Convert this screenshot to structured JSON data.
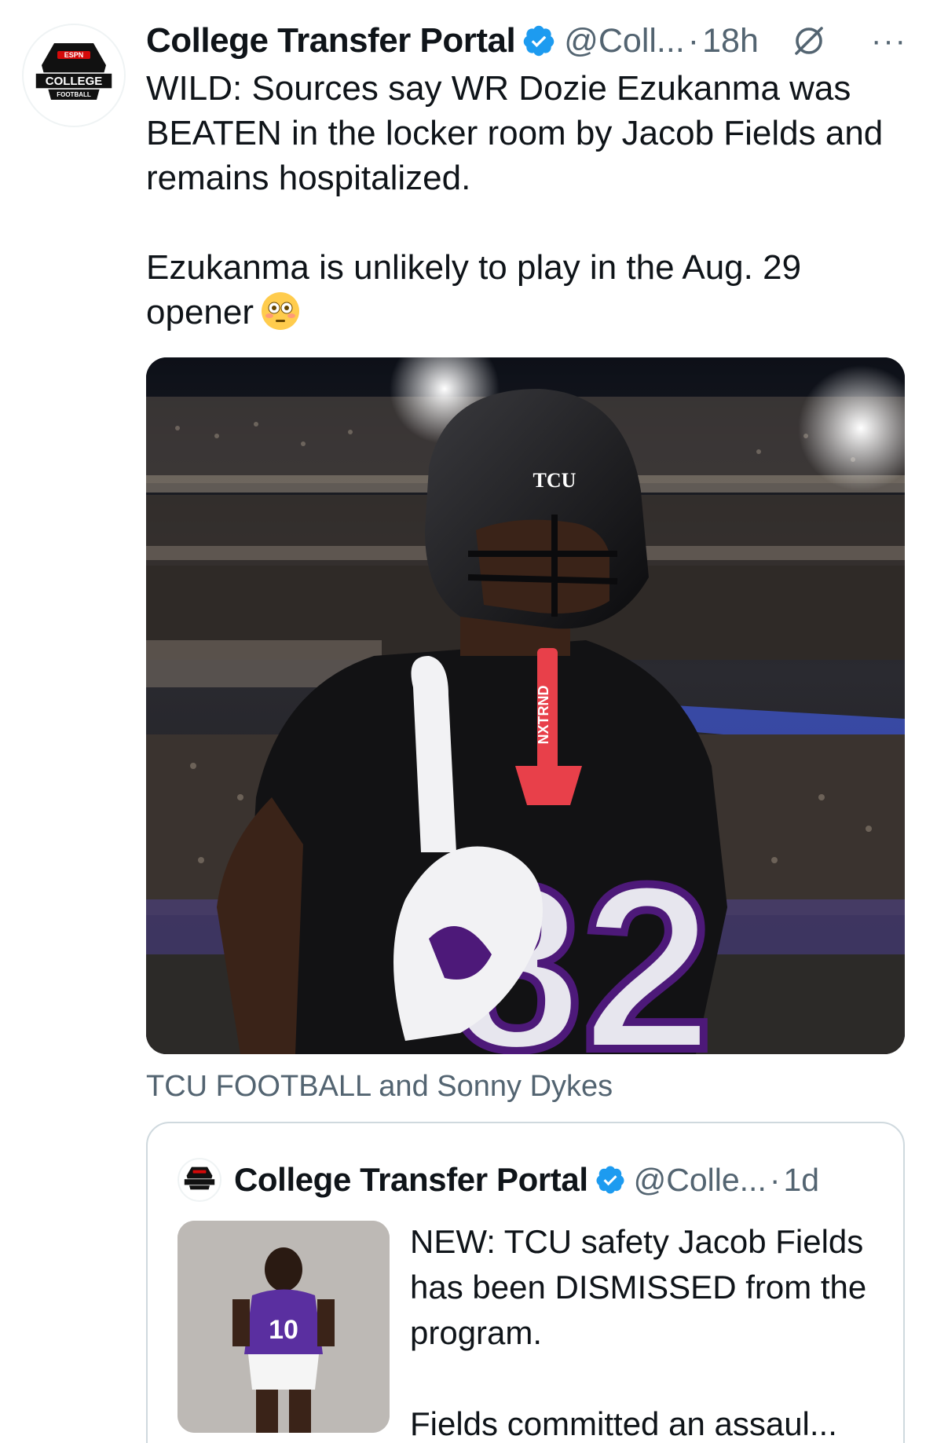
{
  "tweet": {
    "author_name": "College Transfer Portal",
    "handle": "@Coll...",
    "separator": "·",
    "time": "18h",
    "more_label": "···",
    "text": "WILD: Sources say WR Dozie Ezukanma was BEATEN in the locker room by Jacob Fields and remains hospitalized.\n\nEzukanma is unlikely to play in the Aug. 29 opener",
    "emoji": "flushed-face-emoji",
    "avatar_logo_text": "COLLEGE",
    "avatar_logo_subtext": "FOOTBALL",
    "avatar_logo_brand": "ESPN"
  },
  "media": {
    "alt_helmet_text": "TCU",
    "jersey_number": "82",
    "mouthguard_text": "NXTRND",
    "caption": "TCU FOOTBALL and Sonny Dykes"
  },
  "quote": {
    "author_name": "College Transfer Portal",
    "handle": "@Colle...",
    "separator": "·",
    "time": "1d",
    "text": "NEW: TCU safety Jacob Fields has been DISMISSED from the program.\n\nFields committed an assaul...",
    "thumb_jersey_number": "10"
  },
  "colors": {
    "verified_blue": "#1d9bf0",
    "secondary_text": "#536471",
    "tcu_purple": "#4d1979",
    "border": "#cfd9de"
  }
}
